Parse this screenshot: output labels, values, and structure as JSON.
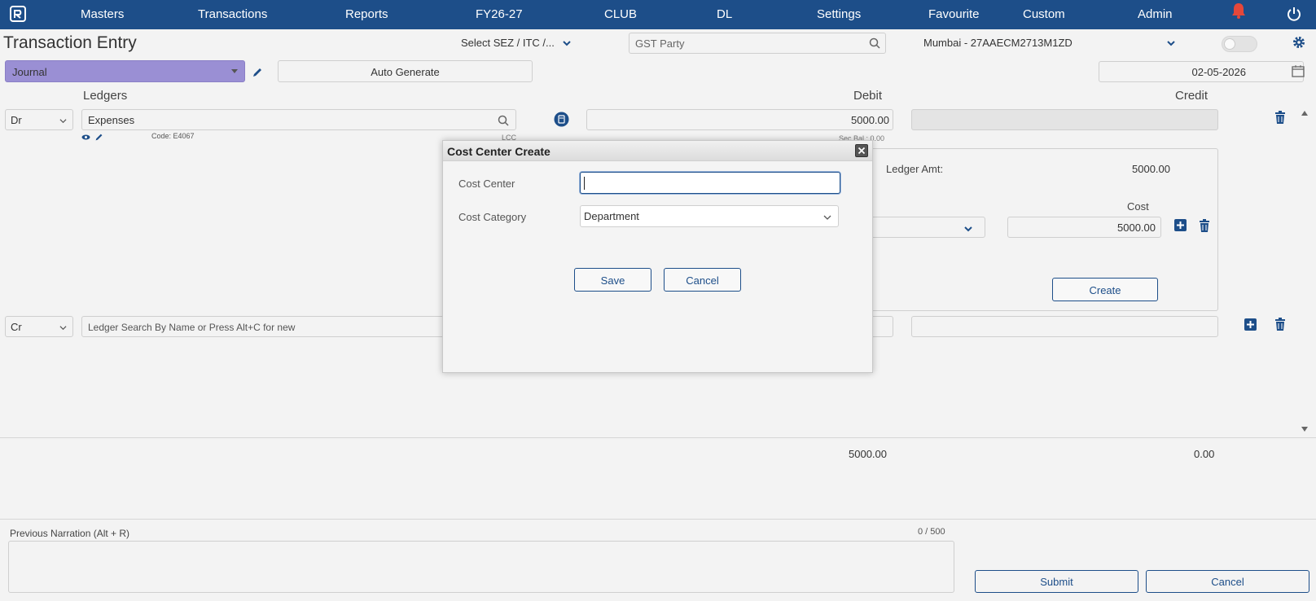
{
  "nav": {
    "items": [
      "Masters",
      "Transactions",
      "Reports",
      "FY26-27",
      "CLUB",
      "DL",
      "Settings",
      "Favourite",
      "Custom",
      "Admin"
    ],
    "brand_color": "#1d4e89"
  },
  "header": {
    "title": "Transaction Entry",
    "sez_select": "Select SEZ / ITC /...",
    "gst_party_placeholder": "GST Party",
    "branch": "Mumbai - 27AAECM2713M1ZD"
  },
  "voucher": {
    "type": "Journal",
    "auto_generate": "Auto Generate",
    "date": "02-05-2026"
  },
  "grid": {
    "headers": {
      "ledgers": "Ledgers",
      "debit": "Debit",
      "credit": "Credit"
    },
    "rows": [
      {
        "drcr": "Dr",
        "ledger": "Expenses",
        "code": "Code: E4067",
        "debit": "5000.00",
        "credit": ""
      },
      {
        "drcr": "Cr",
        "ledger_placeholder": "Ledger Search By Name or Press Alt+C for new",
        "debit": "",
        "credit": ""
      }
    ],
    "lcc_label": "LCC",
    "sec_bal": "Sec Bal : 0.00"
  },
  "cost_allocation": {
    "ledger_amt_label": "Ledger Amt:",
    "ledger_amt_value": "5000.00",
    "cost_label": "Cost",
    "cost_value": "5000.00",
    "create_label": "Create"
  },
  "totals": {
    "debit": "5000.00",
    "credit": "0.00"
  },
  "narration": {
    "prev_label": "Previous Narration (Alt + R)",
    "counter": "0 / 500"
  },
  "actions": {
    "submit": "Submit",
    "cancel": "Cancel"
  },
  "dialog": {
    "title": "Cost Center Create",
    "cost_center_label": "Cost Center",
    "cost_center_value": "",
    "cost_category_label": "Cost Category",
    "cost_category_value": "Department",
    "save": "Save",
    "cancel": "Cancel"
  }
}
